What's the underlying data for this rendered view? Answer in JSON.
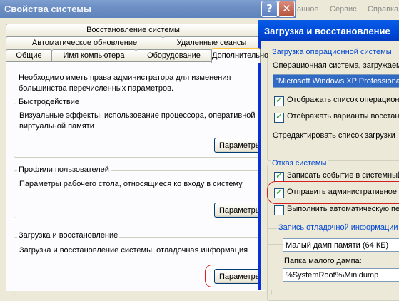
{
  "system_properties": {
    "title": "Свойства системы",
    "help_glyph": "?",
    "close_glyph": "✕",
    "menu": [
      "анное",
      "Сервис",
      "Справка"
    ],
    "tabs_row1": [
      "Восстановление системы"
    ],
    "tabs_row2": [
      "Автоматическое обновление",
      "Удаленные сеансы"
    ],
    "tabs_row3": [
      "Общие",
      "Имя компьютера",
      "Оборудование",
      "Дополнительно"
    ],
    "intro": [
      "Необходимо иметь права администратора для изменения",
      "большинства перечисленных параметров."
    ],
    "performance": {
      "title": "Быстродействие",
      "text": [
        "Визуальные эффекты, использование процессора, оперативной",
        "виртуальной памяти"
      ],
      "button": "Параметры"
    },
    "profiles": {
      "title": "Профили пользователей",
      "text": "Параметры рабочего стола, относящиеся ко входу в систему",
      "button": "Параметры"
    },
    "startup": {
      "title": "Загрузка и восстановление",
      "text": "Загрузка и восстановление системы, отладочная информация",
      "button": "Параметры"
    }
  },
  "startup_recovery": {
    "title": "Загрузка и восстановление",
    "os_group": {
      "title": "Загрузка операционной системы",
      "label": "Операционная система, загружаем",
      "selected_os": "\"Microsoft Windows XP Professional",
      "show_list": "Отображать список операцион",
      "show_recovery": "Отображать варианты восстан",
      "edit_list": "Отредактировать список загрузки"
    },
    "failure_group": {
      "title": "Отказ системы",
      "write_event": "Записать событие в системный",
      "send_alert": "Отправить административное",
      "auto_restart": "Выполнить автоматическую пе"
    },
    "debug_group": {
      "title": "Запись отладочной информации",
      "dump_type": "Малый дамп памяти (64 КБ)",
      "folder_label": "Папка малого дампа:",
      "folder_value": "%SystemRoot%\\Minidump"
    },
    "checks": {
      "show_list": true,
      "show_recovery": true,
      "write_event": true,
      "send_alert": true,
      "auto_restart": false
    }
  }
}
